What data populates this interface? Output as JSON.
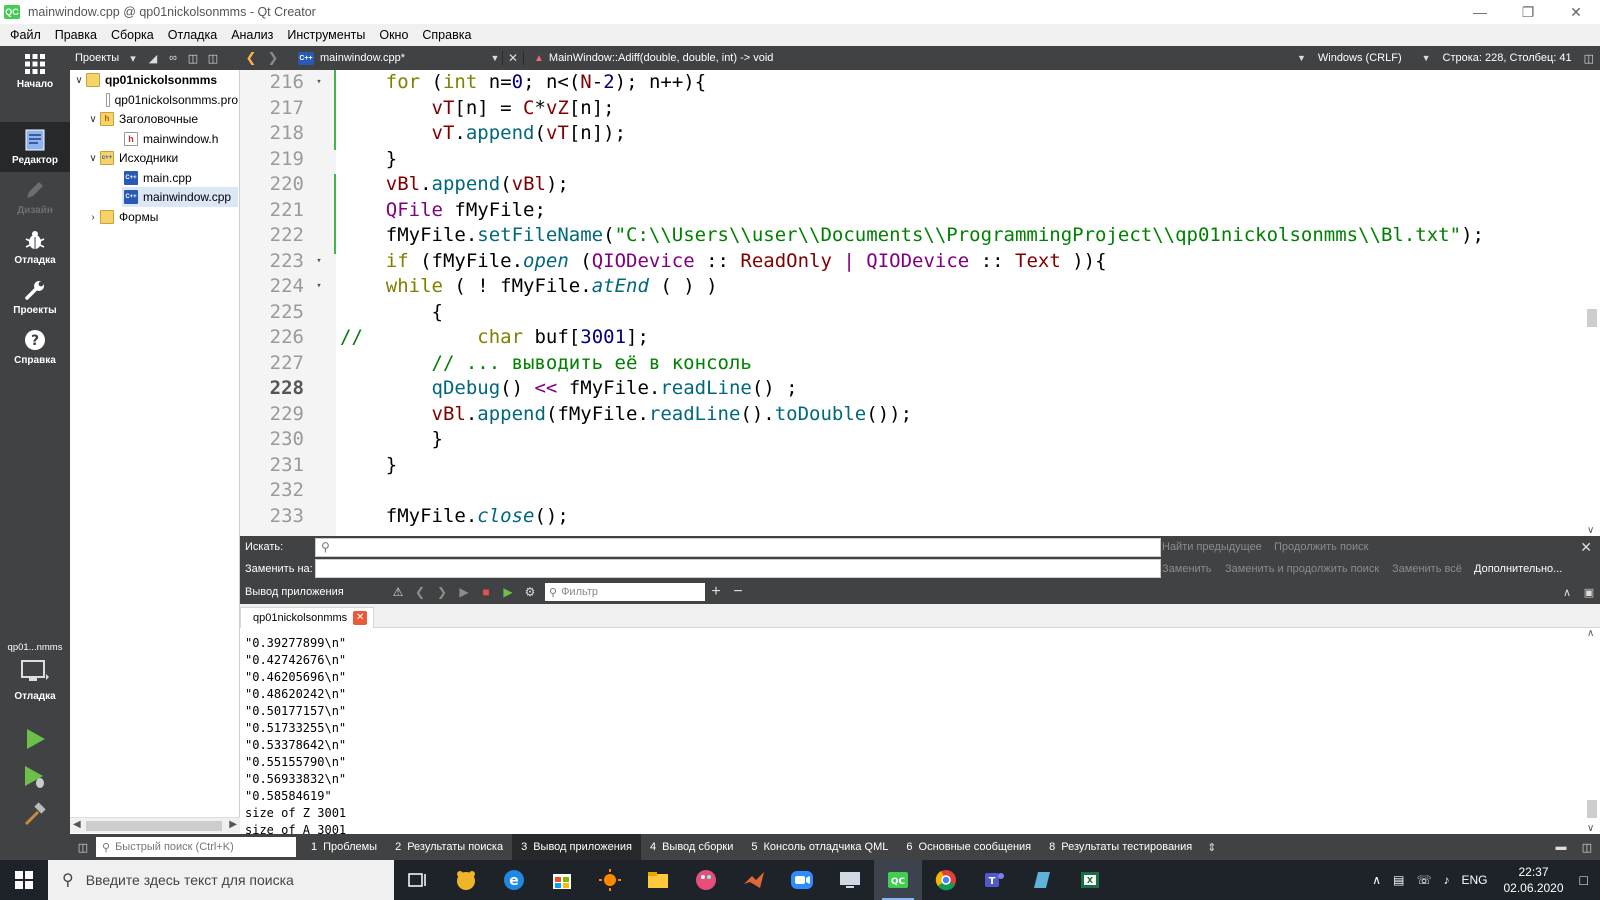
{
  "window": {
    "title": "mainwindow.cpp @ qp01nickolsonmms - Qt Creator",
    "app_icon": "QC",
    "controls": [
      "minimize-icon",
      "restore-icon",
      "close-icon"
    ]
  },
  "menubar": [
    "Файл",
    "Правка",
    "Сборка",
    "Отладка",
    "Анализ",
    "Инструменты",
    "Окно",
    "Справка"
  ],
  "modes": [
    {
      "label": "Начало",
      "icon": "grid-icon",
      "state": "normal"
    },
    {
      "label": "Редактор",
      "icon": "editor-icon",
      "state": "active"
    },
    {
      "label": "Дизайн",
      "icon": "design-pencil-icon",
      "state": "disabled"
    },
    {
      "label": "Отладка",
      "icon": "bug-icon",
      "state": "normal"
    },
    {
      "label": "Проекты",
      "icon": "wrench-icon",
      "state": "normal"
    },
    {
      "label": "Справка",
      "icon": "help-icon",
      "state": "normal"
    }
  ],
  "kit_selector": {
    "label": "qp01...nmms",
    "mode_label": "Отладка"
  },
  "run_buttons": [
    "run-icon",
    "debug-run-icon",
    "build-hammer-icon"
  ],
  "projects_toolbar": {
    "label": "Проекты"
  },
  "editor_toolbar": {
    "file": "mainwindow.cpp*",
    "symbol": "MainWindow::Adiff(double, double, int) -> void",
    "line_ending": "Windows (CRLF)",
    "position": "Строка: 228, Столбец: 41"
  },
  "project_tree": [
    {
      "name": "qp01nickolsonmms",
      "kind": "proj",
      "depth": 0,
      "expanded": true,
      "bold": true
    },
    {
      "name": "qp01nickolsonmms.pro",
      "kind": "filepro",
      "depth": 1
    },
    {
      "name": "Заголовочные",
      "kind": "folderh",
      "depth": 1,
      "expanded": true
    },
    {
      "name": "mainwindow.h",
      "kind": "fileh",
      "depth": 2
    },
    {
      "name": "Исходники",
      "kind": "foldercpp",
      "depth": 1,
      "expanded": true
    },
    {
      "name": "main.cpp",
      "kind": "cpp",
      "depth": 2
    },
    {
      "name": "mainwindow.cpp",
      "kind": "cpp",
      "depth": 2,
      "selected": true
    },
    {
      "name": "Формы",
      "kind": "forms",
      "depth": 1,
      "expanded": false
    }
  ],
  "code": {
    "current_line": 228,
    "lines": [
      {
        "n": 216,
        "fold": "▾",
        "html": "    <span class=\"kw\">for</span> (<span class=\"kw\">int</span> n=<span class=\"num\">0</span>; n&lt;(<span class=\"mem\">N</span>-<span class=\"num\">2</span>); n++){"
      },
      {
        "n": 217,
        "fold": "",
        "html": "        <span class=\"mem\">vT</span>[n] = <span class=\"mem\">C</span>*<span class=\"mem\">vZ</span>[n];"
      },
      {
        "n": 218,
        "fold": "",
        "html": "        <span class=\"mem\">vT</span>.<span class=\"fn\">append</span>(<span class=\"mem\">vT</span>[n]);"
      },
      {
        "n": 219,
        "fold": "",
        "html": "    }"
      },
      {
        "n": 220,
        "fold": "",
        "html": "    <span class=\"mem\">vBl</span>.<span class=\"fn\">append</span>(<span class=\"mem\">vBl</span>);"
      },
      {
        "n": 221,
        "fold": "",
        "html": "    <span class=\"ty\">QFile</span> fMyFile;"
      },
      {
        "n": 222,
        "fold": "",
        "html": "    fMyFile.<span class=\"fn\">setFileName</span>(<span class=\"str\">\"C:\\\\Users\\\\user\\\\Documents\\\\ProgrammingProject\\\\qp01nickolsonmms\\\\Bl.txt\"</span>);"
      },
      {
        "n": 223,
        "fold": "▾",
        "html": "    <span class=\"kw\">if</span> (fMyFile.<span class=\"it\">open</span> (<span class=\"ty\">QIODevice</span> :: <span class=\"mem\">ReadOnly</span> <span class=\"ty\">|</span> <span class=\"ty\">QIODevice</span> :: <span class=\"mem\">Text</span> )){"
      },
      {
        "n": 224,
        "fold": "▾",
        "html": "    <span class=\"kw\">while</span> ( ! fMyFile.<span class=\"it\">atEnd</span> ( ) )"
      },
      {
        "n": 225,
        "fold": "",
        "html": "        {"
      },
      {
        "n": 226,
        "fold": "",
        "html": "<span class=\"cmt\">//</span>          <span class=\"kw\">char</span> buf[<span class=\"num\">3001</span>];"
      },
      {
        "n": 227,
        "fold": "",
        "html": "        <span class=\"cmt\">// ... выводить её в консоль</span>"
      },
      {
        "n": 228,
        "fold": "",
        "html": "        <span class=\"fn\">qDebug</span>() <span class=\"ty\">&lt;&lt;</span> fMyFile.<span class=\"fn\">readLine</span>() ;"
      },
      {
        "n": 229,
        "fold": "",
        "html": "        <span class=\"mem\">vBl</span>.<span class=\"fn\">append</span>(fMyFile.<span class=\"fn\">readLine</span>().<span class=\"fn\">toDouble</span>());"
      },
      {
        "n": 230,
        "fold": "",
        "html": "        }"
      },
      {
        "n": 231,
        "fold": "",
        "html": "    }"
      },
      {
        "n": 232,
        "fold": "",
        "html": ""
      },
      {
        "n": 233,
        "fold": "",
        "html": "    fMyFile.<span class=\"it\">close</span>();"
      }
    ]
  },
  "findbar": {
    "find_label": "Искать:",
    "replace_label": "Заменить на:",
    "find_value": "",
    "replace_value": "",
    "find_prev": "Найти предыдущее",
    "find_next": "Продолжить поиск",
    "replace": "Заменить",
    "replace_next": "Заменить и продолжить поиск",
    "replace_all": "Заменить всё",
    "advanced": "Дополнительно..."
  },
  "output": {
    "title": "Вывод приложения",
    "filter_placeholder": "Фильтр",
    "tab": "qp01nickolsonmms",
    "lines": [
      "\"0.39277899\\n\"",
      "\"0.42742676\\n\"",
      "\"0.46205696\\n\"",
      "\"0.48620242\\n\"",
      "\"0.50177157\\n\"",
      "\"0.51733255\\n\"",
      "\"0.53378642\\n\"",
      "\"0.55155790\\n\"",
      "\"0.56933832\\n\"",
      "\"0.58584619\"",
      "size of Z 3001",
      "size of A 3001"
    ]
  },
  "statusbar": {
    "locator_placeholder": "Быстрый поиск (Ctrl+K)",
    "panes": [
      {
        "n": "1",
        "label": "Проблемы"
      },
      {
        "n": "2",
        "label": "Результаты поиска"
      },
      {
        "n": "3",
        "label": "Вывод приложения",
        "active": true
      },
      {
        "n": "4",
        "label": "Вывод сборки"
      },
      {
        "n": "5",
        "label": "Консоль отладчика QML"
      },
      {
        "n": "6",
        "label": "Основные сообщения"
      },
      {
        "n": "8",
        "label": "Результаты тестирования"
      }
    ]
  },
  "taskbar": {
    "search_placeholder": "Введите здесь текст для поиска",
    "apps": [
      "task-view-icon",
      "app-bear-icon",
      "edge-icon",
      "store-icon",
      "sun-app-icon",
      "file-explorer-icon",
      "paint-icon",
      "matlab-icon",
      "zoom-icon",
      "remote-desktop-icon",
      "qt-creator-icon",
      "chrome-icon",
      "teams-icon",
      "notepad-icon",
      "excel-icon"
    ],
    "active_app": "qt-creator-icon",
    "language": "ENG",
    "time": "22:37",
    "date": "02.06.2020"
  },
  "colors": {
    "sidebar_bg": "#404244",
    "sidebar_active": "#262829",
    "keyword": "#808000",
    "type": "#800080",
    "string": "#008000",
    "member": "#800000",
    "function": "#00677c",
    "number": "#000080",
    "change_marker": "#43b54a"
  }
}
